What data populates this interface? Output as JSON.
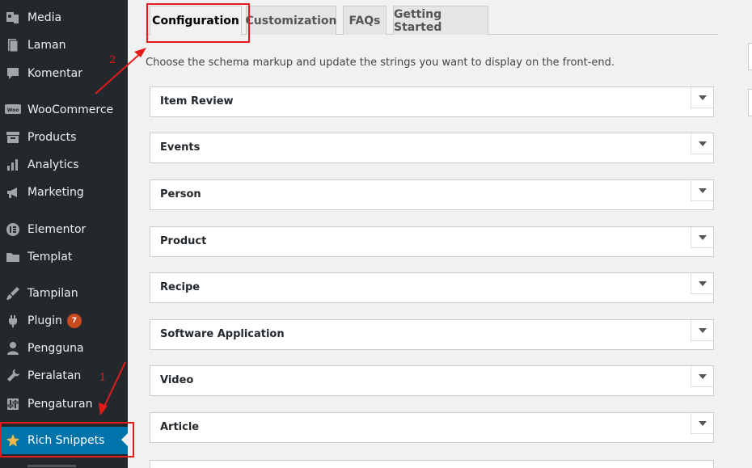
{
  "sidebar": {
    "items": [
      {
        "label": "Media",
        "icon": "media-icon"
      },
      {
        "label": "Laman",
        "icon": "page-icon"
      },
      {
        "label": "Komentar",
        "icon": "comment-icon"
      },
      {
        "label": "WooCommerce",
        "icon": "woocommerce-icon"
      },
      {
        "label": "Products",
        "icon": "archive-icon"
      },
      {
        "label": "Analytics",
        "icon": "chart-bar-icon"
      },
      {
        "label": "Marketing",
        "icon": "megaphone-icon"
      },
      {
        "label": "Elementor",
        "icon": "elementor-icon"
      },
      {
        "label": "Templat",
        "icon": "folder-icon"
      },
      {
        "label": "Tampilan",
        "icon": "brush-icon"
      },
      {
        "label": "Plugin",
        "icon": "plugin-icon",
        "badge": "7"
      },
      {
        "label": "Pengguna",
        "icon": "user-icon"
      },
      {
        "label": "Peralatan",
        "icon": "wrench-icon"
      },
      {
        "label": "Pengaturan",
        "icon": "settings-icon"
      },
      {
        "label": "Rich Snippets",
        "icon": "star-icon",
        "active": true
      }
    ]
  },
  "tabs": [
    {
      "label": "Configuration",
      "active": true
    },
    {
      "label": "Customization"
    },
    {
      "label": "FAQs"
    },
    {
      "label": "Getting Started"
    }
  ],
  "description": "Choose the schema markup and update the strings you want to display on the front-end.",
  "sections": [
    {
      "title": "Item Review"
    },
    {
      "title": "Events"
    },
    {
      "title": "Person"
    },
    {
      "title": "Product"
    },
    {
      "title": "Recipe"
    },
    {
      "title": "Software Application"
    },
    {
      "title": "Video"
    },
    {
      "title": "Article"
    }
  ],
  "annotations": {
    "step1": "1",
    "step2": "2",
    "color": "#e31b1b"
  },
  "colors": {
    "sidebar_bg": "#23282d",
    "active_bg": "#0073aa",
    "badge_bg": "#ca4a1f"
  }
}
